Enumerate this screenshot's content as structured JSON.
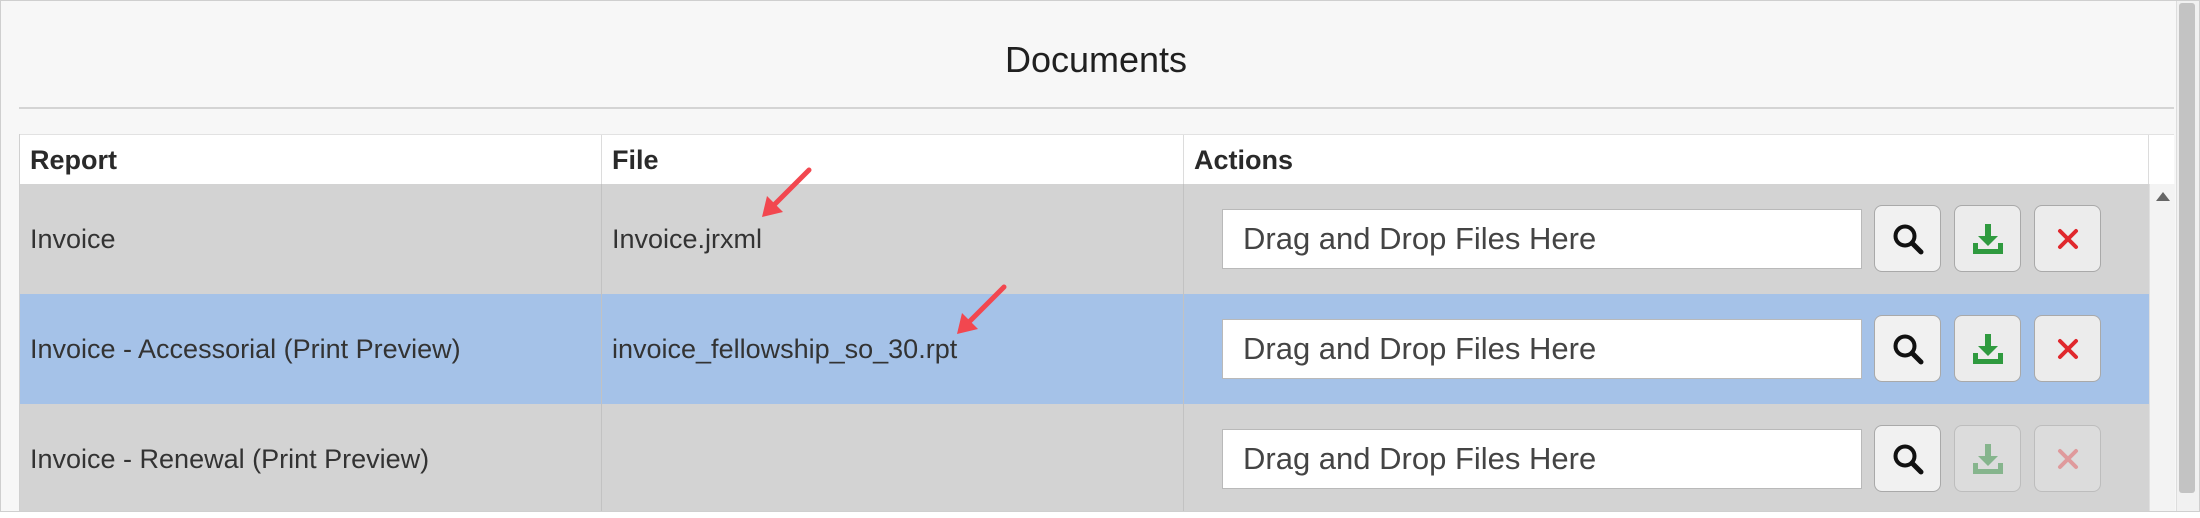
{
  "page": {
    "title": "Documents"
  },
  "table": {
    "columns": [
      "Report",
      "File",
      "Actions"
    ],
    "rows": [
      {
        "report": "Invoice",
        "file": "Invoice.jrxml",
        "dropzone": "Drag and Drop Files Here",
        "upload_enabled": true,
        "remove_enabled": true,
        "selected": false
      },
      {
        "report": "Invoice - Accessorial (Print Preview)",
        "file": "invoice_fellowship_so_30.rpt",
        "dropzone": "Drag and Drop Files Here",
        "upload_enabled": true,
        "remove_enabled": true,
        "selected": true
      },
      {
        "report": "Invoice - Renewal (Print Preview)",
        "file": "",
        "dropzone": "Drag and Drop Files Here",
        "upload_enabled": false,
        "remove_enabled": false,
        "selected": false
      }
    ]
  },
  "icons": {
    "search": "search-icon",
    "upload": "upload-icon",
    "remove": "remove-icon",
    "annotation": "red-arrow-icon",
    "scroll_up": "chevron-up-icon"
  },
  "colors": {
    "selected_row": "#a5c2e8",
    "row_bg": "#d3d3d3",
    "upload_green": "#2f9a3f",
    "remove_red": "#e0282d",
    "annotation_red": "#f2474f"
  }
}
